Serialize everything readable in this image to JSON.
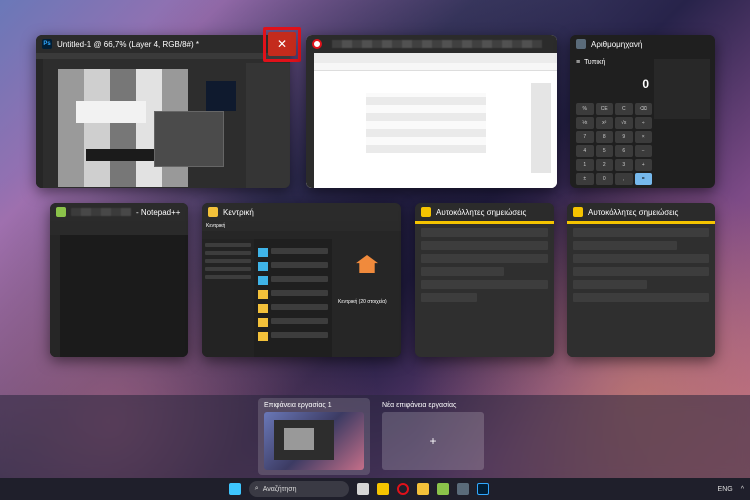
{
  "windows": {
    "photoshop": {
      "title": "Untitled-1 @ 66,7% (Layer 4, RGB/8#) *",
      "icon_text": "Ps"
    },
    "opera": {
      "title": ""
    },
    "calculator": {
      "title": "Αριθμομηχανή",
      "mode": "Τυπική",
      "display": "0"
    },
    "notepad": {
      "title": "- Notepad++"
    },
    "explorer": {
      "title": "Κεντρική",
      "path": "Κεντρική",
      "panel_title": "Κεντρική (20 στοιχεία)"
    },
    "sticky1": {
      "title": "Αυτοκόλλητες σημειώσεις"
    },
    "sticky2": {
      "title": "Αυτοκόλλητες σημειώσεις"
    }
  },
  "close_button": {
    "glyph": "✕"
  },
  "desktops": {
    "desktop1": {
      "label": "Επιφάνεια εργασίας 1"
    },
    "new_desktop": {
      "label": "Νέα επιφάνεια εργασίας",
      "glyph": "+"
    }
  },
  "taskbar": {
    "search_placeholder": "Αναζήτηση",
    "language": "ENG",
    "icons": [
      "start-icon",
      "search-icon",
      "task-view-icon",
      "sticky-notes-icon",
      "opera-icon",
      "file-explorer-icon",
      "notepadpp-icon",
      "calculator-icon",
      "photoshop-icon"
    ]
  },
  "colors": {
    "close_red": "#c42b1c",
    "highlight_red": "#e0111a",
    "sticky_yellow": "#f5c400",
    "ps_blue": "#31a8ff"
  }
}
